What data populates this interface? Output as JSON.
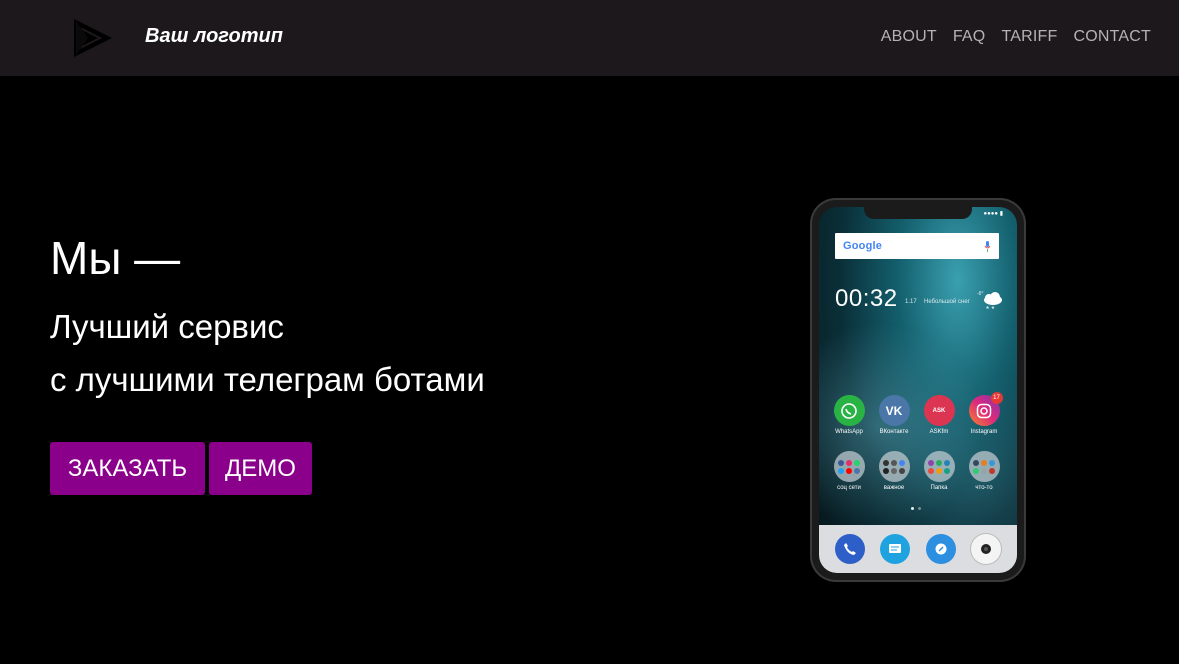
{
  "header": {
    "brand": "Ваш логотип",
    "logo_icon": "play-triangle-icon",
    "nav": [
      "ABOUT",
      "FAQ",
      "TARIFF",
      "CONTACT"
    ]
  },
  "hero": {
    "title": "Мы —",
    "subtitle_line1": "Лучший сервис",
    "subtitle_line2": "с лучшими телеграм ботами",
    "order_button": "ЗАКАЗАТЬ",
    "demo_button": "ДЕМО"
  },
  "phone": {
    "search_logo": "Google",
    "clock": "00:32",
    "clock_date": "1.17",
    "weather_temp": "-8°",
    "weather_text": "Небольшой снег",
    "apps": [
      {
        "label": "WhatsApp",
        "icon": "whatsapp-icon",
        "color": "#2ab345"
      },
      {
        "label": "ВКонтакте",
        "icon": "vk-icon",
        "color": "#4a76a8"
      },
      {
        "label": "ASKfm",
        "icon": "askfm-icon",
        "color": "#db3552"
      },
      {
        "label": "Instagram",
        "icon": "instagram-icon",
        "color": "#c13584",
        "badge": "17"
      }
    ],
    "folders": [
      {
        "label": "соц сети"
      },
      {
        "label": "важное"
      },
      {
        "label": "Папка"
      },
      {
        "label": "что-то"
      }
    ],
    "dock": [
      "phone-icon",
      "messages-icon",
      "browser-icon",
      "camera-icon"
    ]
  },
  "colors": {
    "accent": "#8b008b",
    "navbar": "#1c181b",
    "nav_link": "#b5b2b5"
  }
}
